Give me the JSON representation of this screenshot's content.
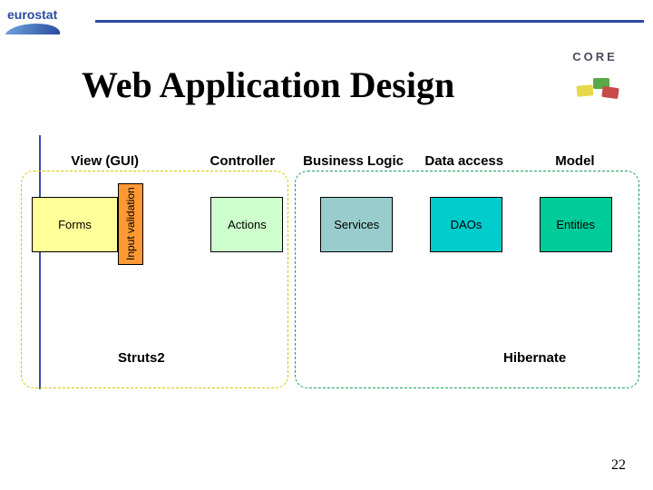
{
  "logo_text": "eurostat",
  "core_text": "CORE",
  "title": "Web Application Design",
  "headers": {
    "view": "View (GUI)",
    "controller": "Controller",
    "business": "Business Logic",
    "data": "Data access",
    "model": "Model"
  },
  "row": {
    "forms": "Forms",
    "inputval": "Input validation",
    "actions": "Actions",
    "services": "Services",
    "daos": "DAOs",
    "entities": "Entities"
  },
  "regions": {
    "left": "Struts2",
    "right": "Hibernate"
  },
  "page_number": "22"
}
